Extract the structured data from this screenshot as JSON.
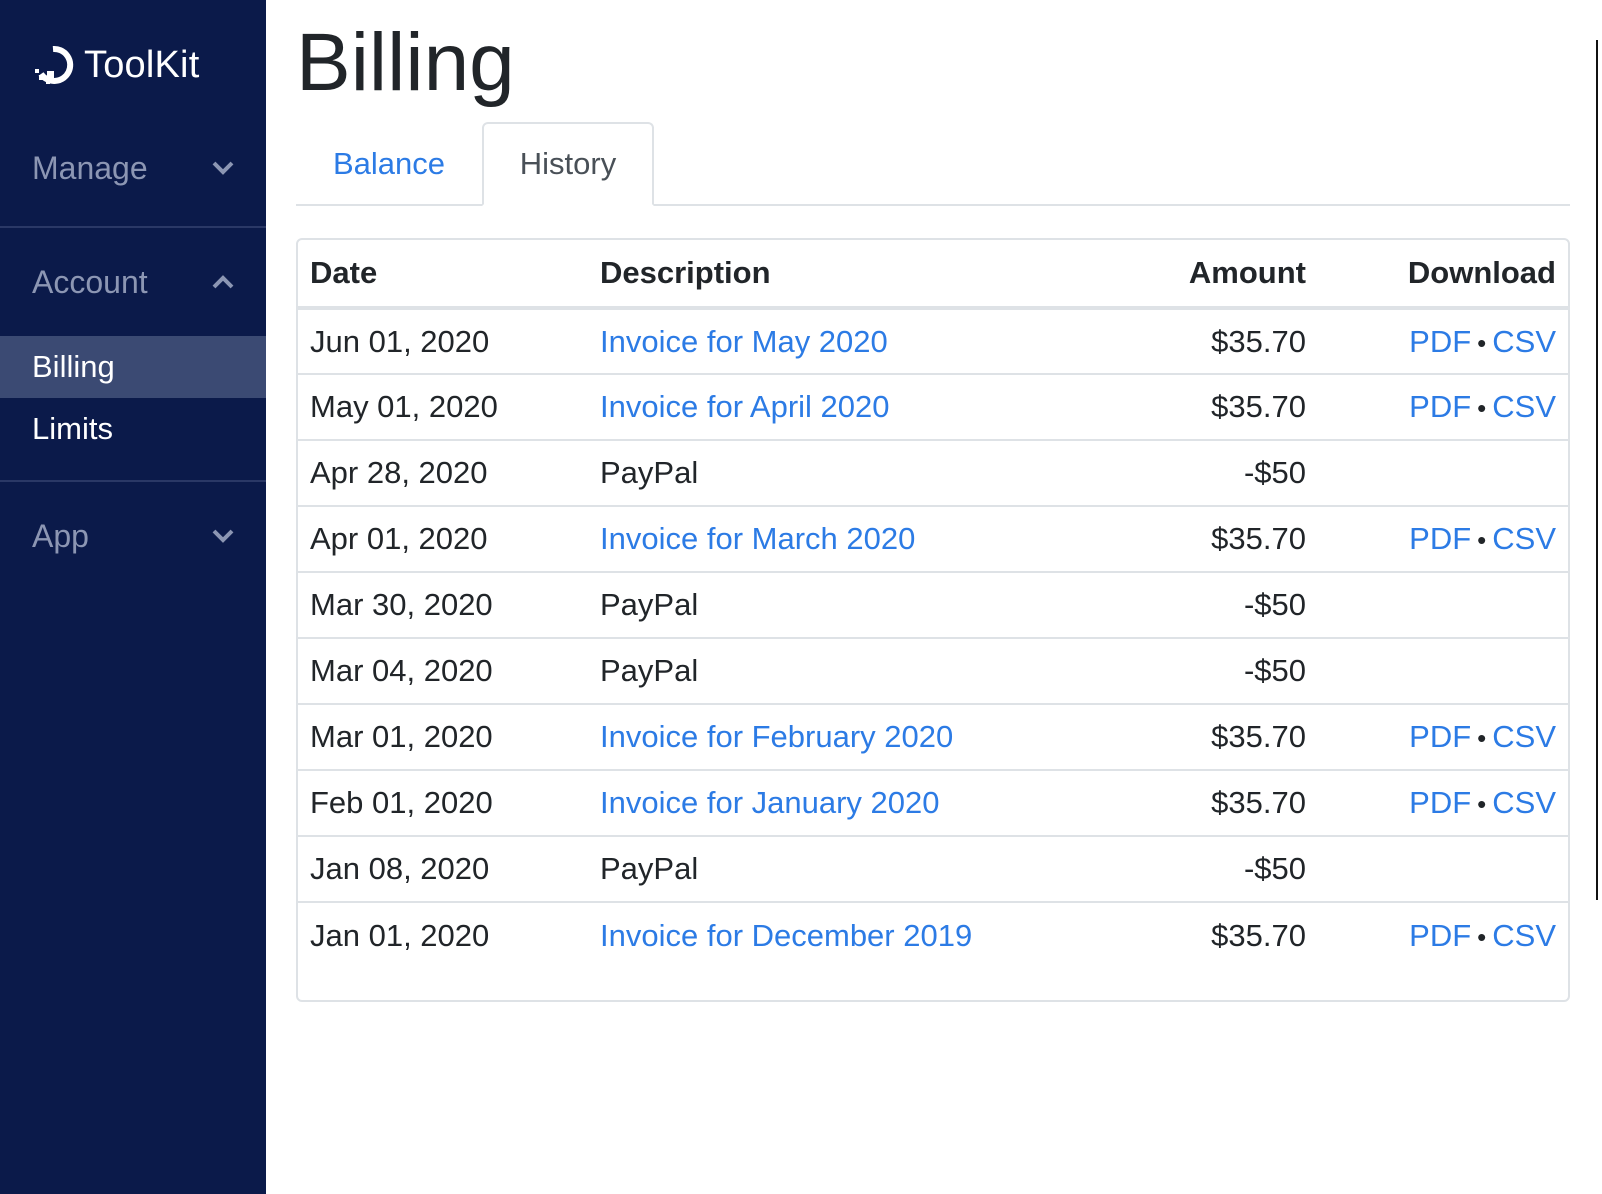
{
  "app": {
    "name": "ToolKit"
  },
  "sidebar": {
    "sections": [
      {
        "label": "Manage",
        "expanded": false
      },
      {
        "label": "Account",
        "expanded": true,
        "items": [
          {
            "label": "Billing",
            "active": true
          },
          {
            "label": "Limits",
            "active": false
          }
        ]
      },
      {
        "label": "App",
        "expanded": false
      }
    ]
  },
  "page": {
    "title": "Billing"
  },
  "tabs": [
    {
      "label": "Balance",
      "active": false
    },
    {
      "label": "History",
      "active": true
    }
  ],
  "table": {
    "headers": {
      "date": "Date",
      "description": "Description",
      "amount": "Amount",
      "download": "Download"
    },
    "rows": [
      {
        "date": "Jun 01, 2020",
        "description": "Invoice for May 2020",
        "amount": "$35.70",
        "is_invoice": true,
        "pdf": "PDF",
        "csv": "CSV"
      },
      {
        "date": "May 01, 2020",
        "description": "Invoice for April 2020",
        "amount": "$35.70",
        "is_invoice": true,
        "pdf": "PDF",
        "csv": "CSV"
      },
      {
        "date": "Apr 28, 2020",
        "description": "PayPal",
        "amount": "-$50",
        "is_invoice": false
      },
      {
        "date": "Apr 01, 2020",
        "description": "Invoice for March 2020",
        "amount": "$35.70",
        "is_invoice": true,
        "pdf": "PDF",
        "csv": "CSV"
      },
      {
        "date": "Mar 30, 2020",
        "description": "PayPal",
        "amount": "-$50",
        "is_invoice": false
      },
      {
        "date": "Mar 04, 2020",
        "description": "PayPal",
        "amount": "-$50",
        "is_invoice": false
      },
      {
        "date": "Mar 01, 2020",
        "description": "Invoice for February 2020",
        "amount": "$35.70",
        "is_invoice": true,
        "pdf": "PDF",
        "csv": "CSV"
      },
      {
        "date": "Feb 01, 2020",
        "description": "Invoice for January 2020",
        "amount": "$35.70",
        "is_invoice": true,
        "pdf": "PDF",
        "csv": "CSV"
      },
      {
        "date": "Jan 08, 2020",
        "description": "PayPal",
        "amount": "-$50",
        "is_invoice": false
      },
      {
        "date": "Jan 01, 2020",
        "description": "Invoice for December 2019",
        "amount": "$35.70",
        "is_invoice": true,
        "pdf": "PDF",
        "csv": "CSV"
      }
    ],
    "download_separator": "•"
  },
  "colors": {
    "sidebar_bg": "#0b1a4a",
    "active_item_bg": "#3b4a73",
    "link": "#2c7be5",
    "muted_nav": "#8c96b3"
  },
  "icons": {
    "logo": "toolkit-logo-icon",
    "collapsed": "chevron-down-icon",
    "expanded": "chevron-up-icon"
  }
}
